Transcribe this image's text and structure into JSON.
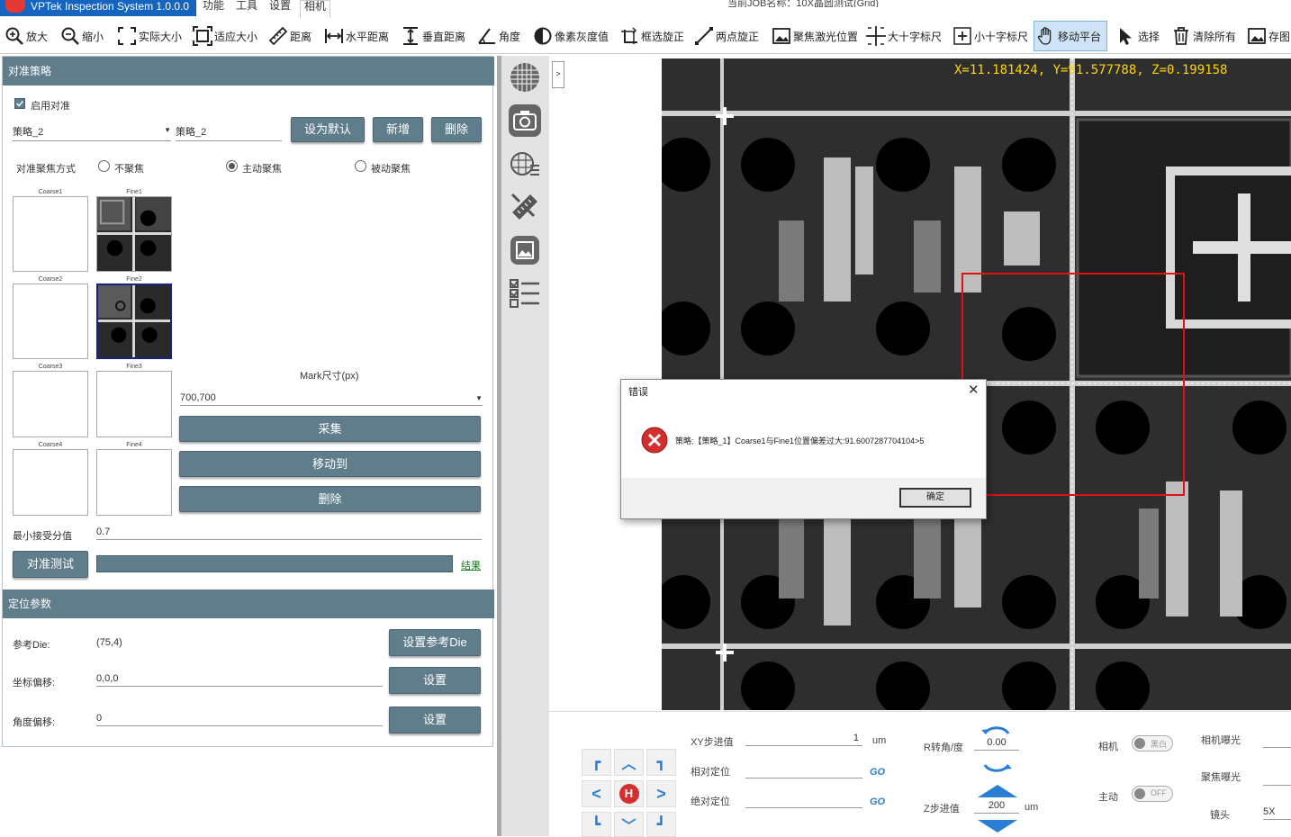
{
  "app": {
    "title": "VPTek Inspection System 1.0.0.0",
    "job_label": "当前JOB名称：10X晶圆测试(Grid)"
  },
  "menu": [
    "功能",
    "工具",
    "设置",
    "相机"
  ],
  "toolbar": {
    "zoom_in": "放大",
    "zoom_out": "缩小",
    "actual_size": "实际大小",
    "fit_size": "适应大小",
    "distance": "距离",
    "h_distance": "水平距离",
    "v_distance": "垂直距离",
    "angle": "角度",
    "pixel_gray": "像素灰度值",
    "box_rotate": "框选旋正",
    "two_point_rotate": "两点旋正",
    "focus_laser": "聚焦激光位置",
    "big_cross": "大十字标尺",
    "small_cross": "小十字标尺",
    "move_stage": "移动平台",
    "select": "选择",
    "clear_all": "清除所有",
    "save_image": "存图"
  },
  "align": {
    "header": "对准策略",
    "enable_label": "启用对准",
    "strategy_select": "策略_2",
    "strategy_name": "策略_2",
    "btn_default": "设为默认",
    "btn_add": "新增",
    "btn_delete": "删除",
    "focus_mode_label": "对准聚焦方式",
    "focus_none": "不聚焦",
    "focus_active": "主动聚焦",
    "focus_passive": "被动聚焦",
    "thumbs": {
      "c1": "Coarse1",
      "f1": "Fine1",
      "c2": "Coarse2",
      "f2": "Fine2",
      "c3": "Coarse3",
      "f3": "Fine3",
      "c4": "Coarse4",
      "f4": "Fine4"
    },
    "mark_size_label": "Mark尺寸(px)",
    "mark_size_value": "700,700",
    "btn_capture": "采集",
    "btn_move": "移动到",
    "btn_remove": "删除",
    "min_score_label": "最小接受分值",
    "min_score_value": "0.7",
    "btn_test": "对准测试",
    "result_link": "结果"
  },
  "locate": {
    "header": "定位参数",
    "ref_die_label": "参考Die:",
    "ref_die_value": "(75,4)",
    "btn_ref_die": "设置参考Die",
    "coord_offset_label": "坐标偏移:",
    "coord_offset_value": "0,0,0",
    "btn_set1": "设置",
    "angle_offset_label": "角度偏移:",
    "angle_offset_value": "0",
    "btn_set2": "设置"
  },
  "viewer": {
    "coords": "X=11.181424, Y=91.577788, Z=0.199158"
  },
  "dialog": {
    "title": "错误",
    "message": "策略:【策略_1】Coarse1与Fine1位置偏差过大:91.6007287704104>5",
    "ok": "确定"
  },
  "stage": {
    "home": "H",
    "xy_step_label": "XY步进值",
    "xy_step_value": "1",
    "xy_unit": "um",
    "rel_pos_label": "相对定位",
    "abs_pos_label": "绝对定位",
    "go": "GO",
    "r_angle_label": "R转角/度",
    "r_angle_value": "0.00",
    "z_step_label": "Z步进值",
    "z_step_value": "200",
    "z_unit": "um",
    "camera_label": "相机",
    "camera_toggle": "黑白",
    "active_label": "主动",
    "active_toggle": "OFF",
    "cam_exposure_label": "相机曝光",
    "focus_exposure_label": "聚焦曝光",
    "lens_label": "镜头",
    "lens_value": "5X"
  }
}
